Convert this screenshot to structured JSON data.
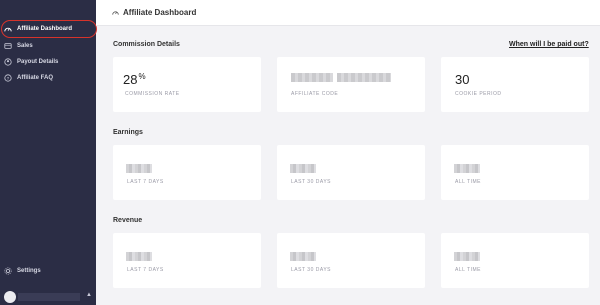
{
  "sidebar": {
    "items": [
      {
        "label": "Affiliate Dashboard",
        "icon": "speedometer-icon"
      },
      {
        "label": "Sales",
        "icon": "wallet-icon"
      },
      {
        "label": "Payout Details",
        "icon": "person-icon"
      },
      {
        "label": "Affiliate FAQ",
        "icon": "question-icon"
      }
    ],
    "settings_label": "Settings"
  },
  "header": {
    "title": "Affiliate Dashboard"
  },
  "commission": {
    "title": "Commission Details",
    "link": "When will I be paid out?",
    "rate_value": "28",
    "rate_unit": "%",
    "rate_label": "COMMISSION RATE",
    "code_label": "AFFILIATE CODE",
    "cookie_value": "30",
    "cookie_label": "COOKIE PERIOD"
  },
  "earnings": {
    "title": "Earnings",
    "labels": [
      "LAST 7 DAYS",
      "LAST 30 DAYS",
      "ALL TIME"
    ]
  },
  "revenue": {
    "title": "Revenue",
    "labels": [
      "LAST 7 DAYS",
      "LAST 30 DAYS",
      "ALL TIME"
    ]
  },
  "colors": {
    "sidebar": "#2b2d45",
    "highlight": "#d6332b",
    "background": "#f3f3f6"
  }
}
